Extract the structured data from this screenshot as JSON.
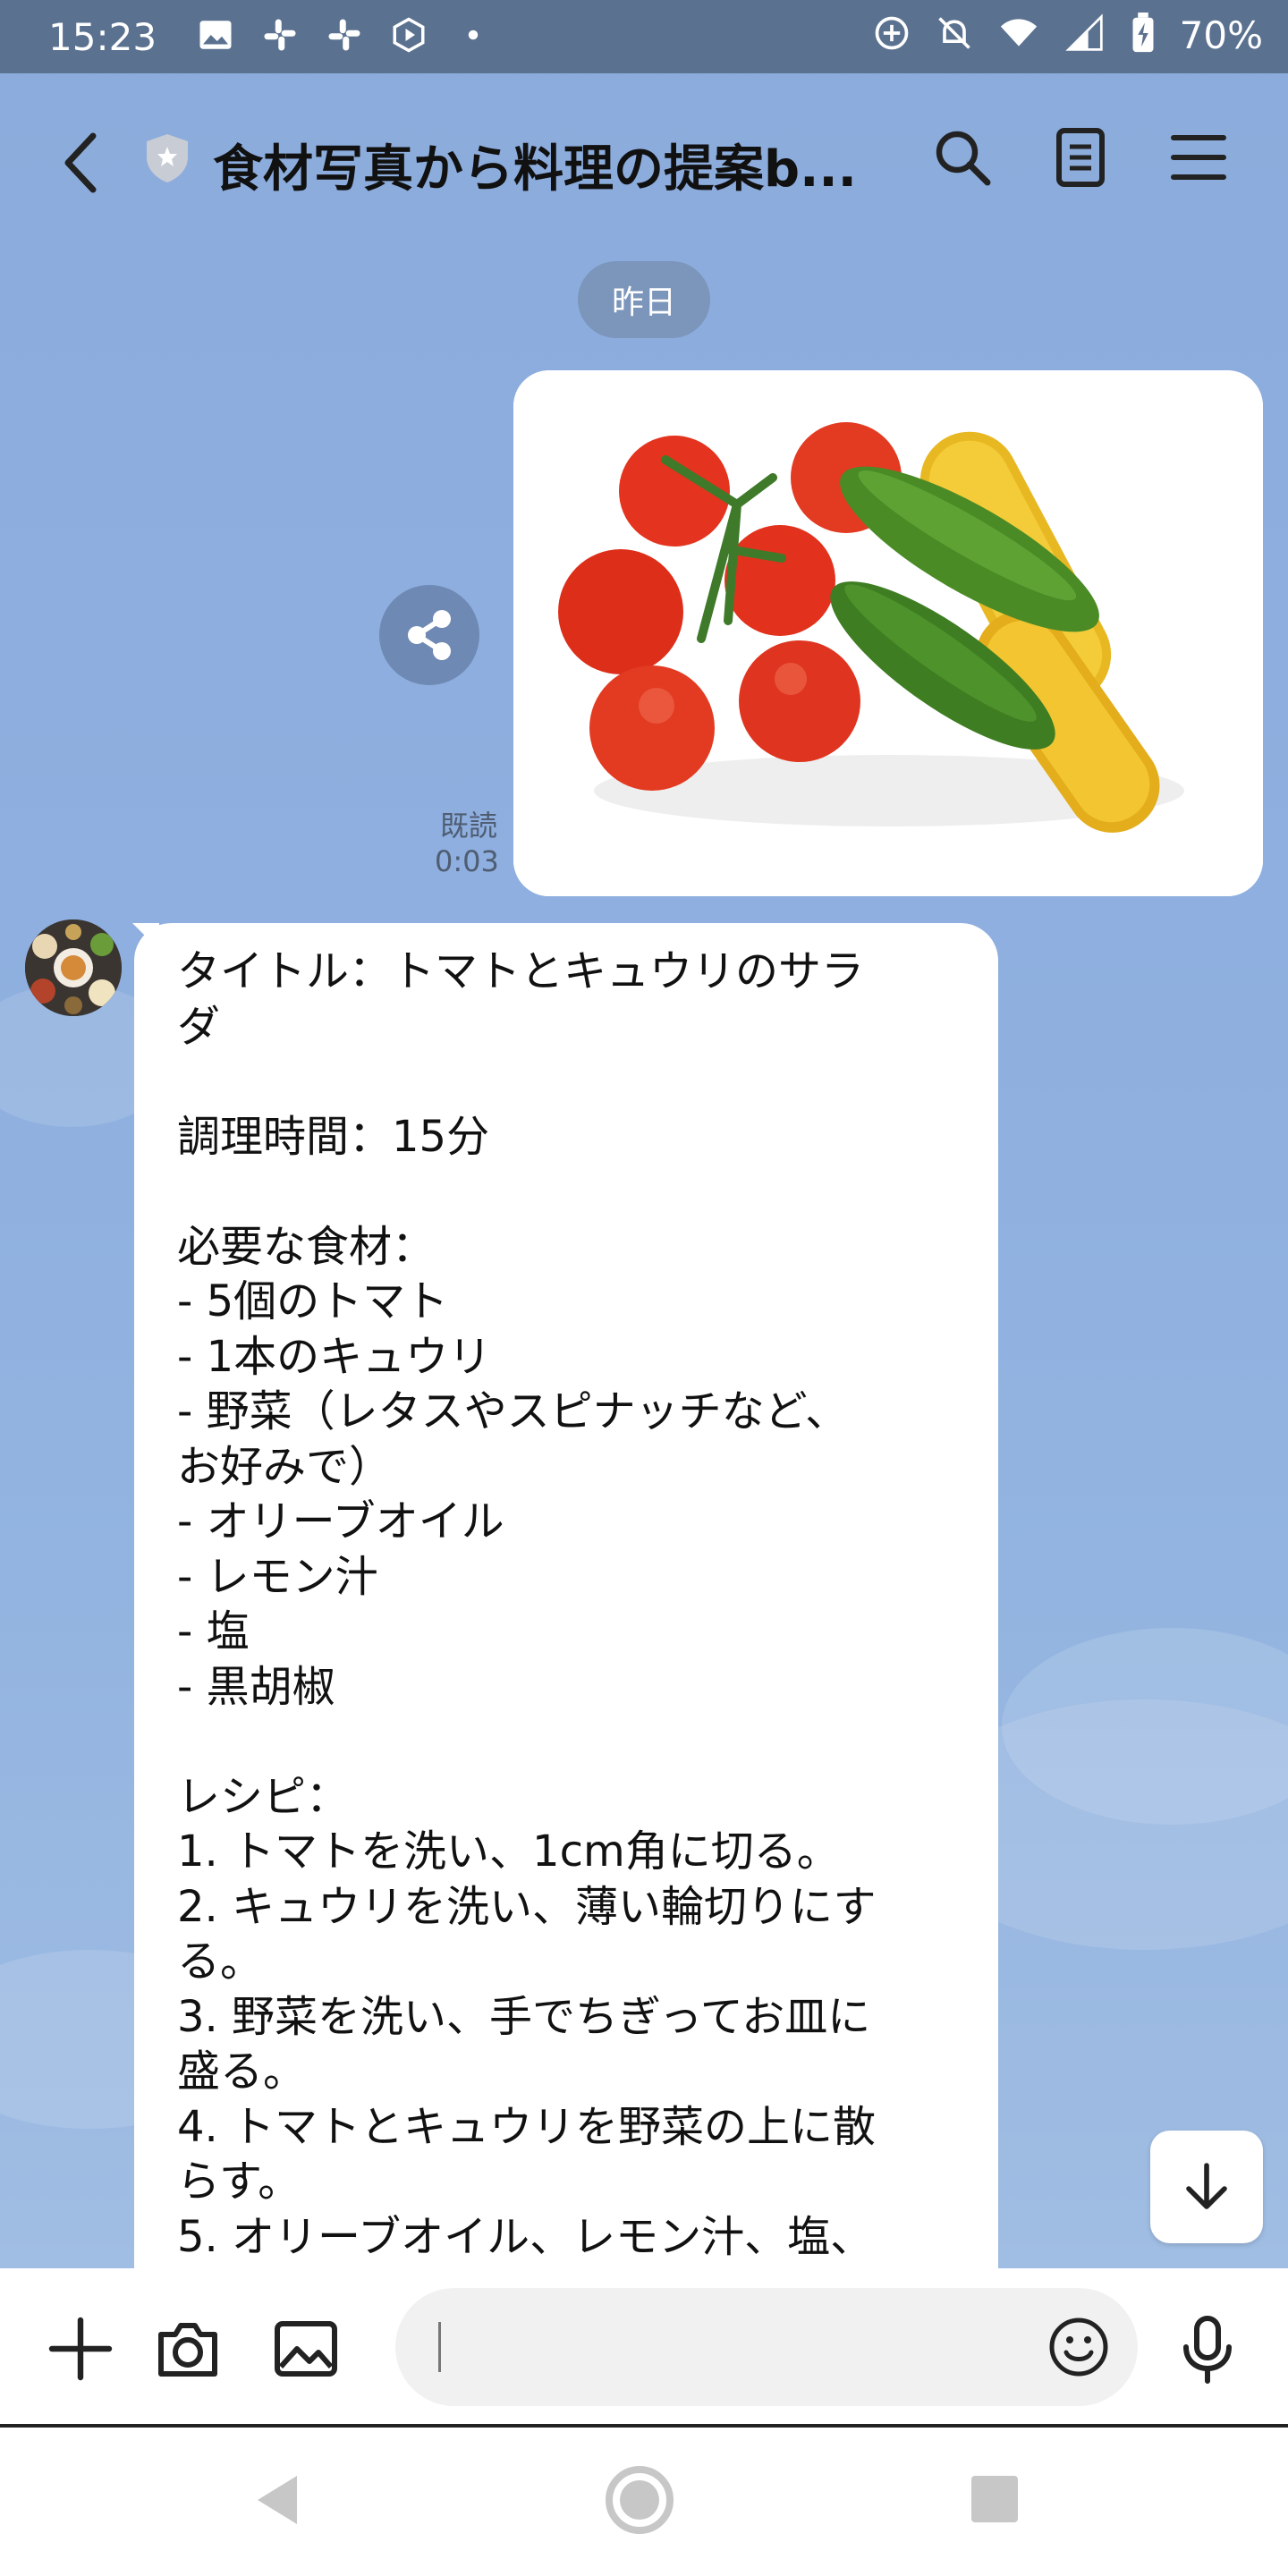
{
  "status_bar": {
    "time": "15:23",
    "battery": "70%",
    "left_icons": [
      "gallery-icon",
      "slack-icon",
      "slack-icon",
      "hexagon-play-icon",
      "dot-icon"
    ],
    "right_icons": [
      "target-icon",
      "bell-off-icon",
      "wifi-icon",
      "signal-icon",
      "battery-icon"
    ]
  },
  "header": {
    "title": "食材写真から料理の提案b...",
    "icons": [
      "back-icon",
      "shield-star-icon",
      "search-icon",
      "notes-icon",
      "menu-icon"
    ]
  },
  "chat": {
    "date_label": "昨日",
    "photo_message": {
      "image_description_icon": "vegetables-photo",
      "read_label": "既読",
      "read_time": "0:03"
    },
    "reply": {
      "text": "タイトル：トマトとキュウリのサラ\nダ\n\n調理時間：15分\n\n必要な食材：\n- 5個のトマト\n- 1本のキュウリ\n- 野菜（レタスやスピナッチなど、\nお好みで）\n- オリーブオイル\n- レモン汁\n- 塩\n- 黒胡椒\n\nレシピ：\n1. トマトを洗い、1cm角に切る。\n2. キュウリを洗い、薄い輪切りにす\nる。\n3. 野菜を洗い、手でちぎってお皿に\n盛る。\n4. トマトとキュウリを野菜の上に散\nらす。\n5. オリーブオイル、レモン汁、塩、"
    }
  },
  "input_bar": {
    "placeholder": "",
    "icons": [
      "plus-icon",
      "camera-icon",
      "image-icon",
      "emoji-icon",
      "microphone-icon"
    ]
  },
  "nav_bar": {
    "icons": [
      "nav-back-icon",
      "nav-home-icon",
      "nav-recents-icon"
    ]
  },
  "colors": {
    "background": "#8eaedd",
    "status_bar": "#5a7190",
    "date_pill": "#7b95bb",
    "bubble": "#ffffff"
  }
}
